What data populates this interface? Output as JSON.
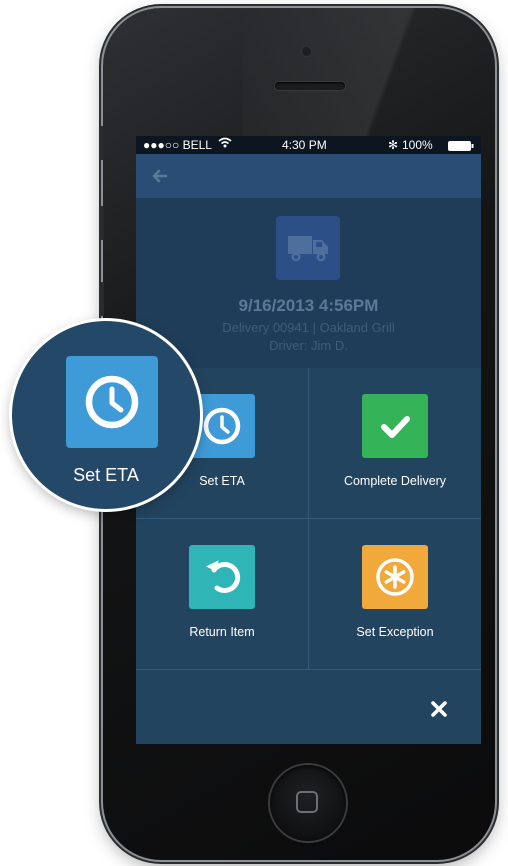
{
  "status_bar": {
    "carrier": "●●●○○ BELL",
    "time": "4:30 PM",
    "bluetooth": "✻",
    "battery": "100%"
  },
  "header": {
    "datetime": "9/16/2013  4:56PM",
    "delivery_info": "Delivery 00941  |  Oakland Grill",
    "driver": "Driver: Jim D."
  },
  "actions": [
    {
      "label": "Set ETA",
      "icon": "clock-icon",
      "color": "#3f9bd8"
    },
    {
      "label": "Complete Delivery",
      "icon": "check-icon",
      "color": "#34b359"
    },
    {
      "label": "Return Item",
      "icon": "return-arrow-icon",
      "color": "#2fb5b5"
    },
    {
      "label": "Set Exception",
      "icon": "asterisk-icon",
      "color": "#f0a93a"
    }
  ],
  "callout": {
    "label": "Set ETA",
    "icon": "clock-icon",
    "color": "#3f9bd8"
  },
  "footer": {
    "close_icon": "close-icon"
  }
}
